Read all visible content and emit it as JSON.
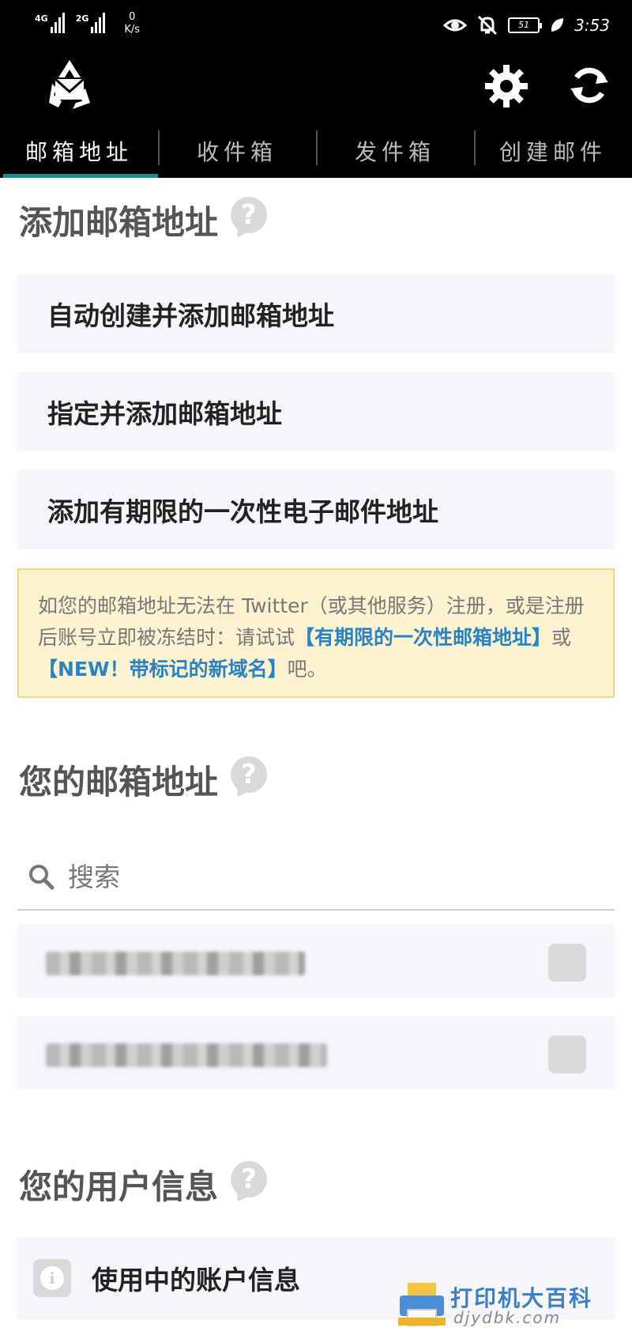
{
  "status_bar": {
    "net1": "4G",
    "net2": "2G",
    "speed_value": "0",
    "speed_unit": "K/s",
    "battery": "51",
    "time": "3:53"
  },
  "app": {
    "logo_icon": "recycle-mail-icon",
    "settings_icon": "gear-icon",
    "refresh_icon": "refresh-icon"
  },
  "tabs": [
    {
      "label": "邮箱地址",
      "active": true
    },
    {
      "label": "收件箱",
      "active": false
    },
    {
      "label": "发件箱",
      "active": false
    },
    {
      "label": "创建邮件",
      "active": false
    }
  ],
  "add_section": {
    "title": "添加邮箱地址",
    "help": "?",
    "actions": [
      {
        "label": "自动创建并添加邮箱地址"
      },
      {
        "label": "指定并添加邮箱地址"
      },
      {
        "label": "添加有期限的一次性电子邮件地址"
      }
    ],
    "notice": {
      "text_before": "如您的邮箱地址无法在 Twitter（或其他服务）注册，或是注册后账号立即被冻结时：请试试",
      "link1": "【有期限的一次性邮箱地址】",
      "middle": "或",
      "link2": "【NEW！带标记的新域名】",
      "text_after": "吧。"
    }
  },
  "addresses_section": {
    "title": "您的邮箱地址",
    "help": "?",
    "search_placeholder": "搜索"
  },
  "user_section": {
    "title": "您的用户信息",
    "help": "?",
    "info_row_label": "使用中的账户信息",
    "info_icon_glyph": "i"
  },
  "watermark": {
    "line1": "打印机大百科",
    "line2": "djydbk.com"
  },
  "colors": {
    "tab_indicator": "#1a8a8a",
    "link": "#2a82c4",
    "notice_bg": "#fbf3cf",
    "card_bg": "#f4f6f9"
  }
}
